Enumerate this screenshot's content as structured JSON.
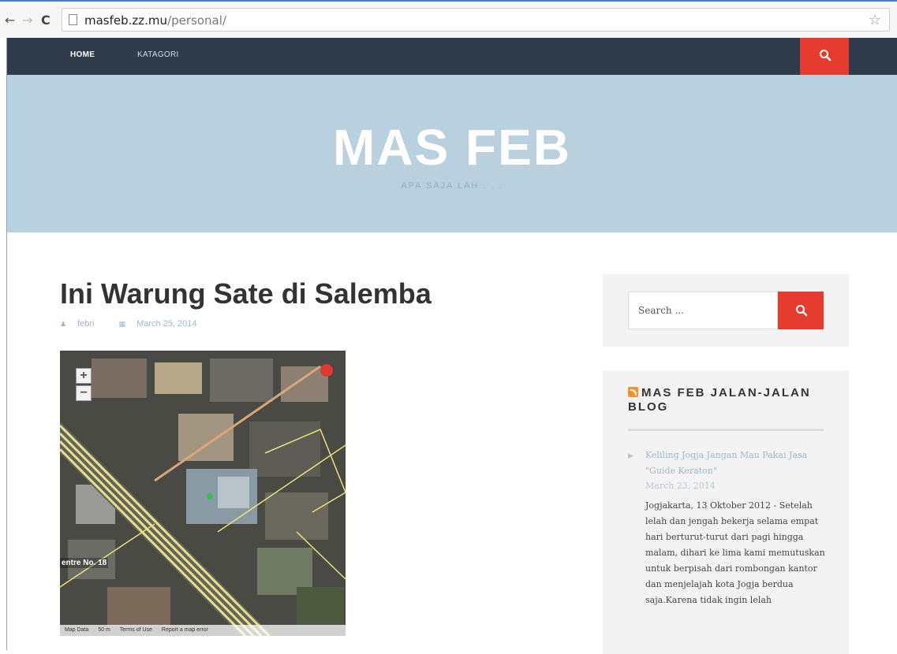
{
  "browser": {
    "back_glyph": "←",
    "forward_glyph": "→",
    "reload_glyph": "C",
    "url_host": "masfeb.zz.mu",
    "url_path": "/personal/",
    "star_glyph": "☆"
  },
  "nav": {
    "home": "HOME",
    "kategori": "KATAGORI"
  },
  "header": {
    "title": "MAS FEB",
    "description": "APA SAJA LAH . . ."
  },
  "post": {
    "title": "Ini Warung Sate di Salemba",
    "author": "febri",
    "date": "March 25, 2014"
  },
  "map": {
    "zoom_in": "+",
    "zoom_out": "−",
    "label": "entre No. 18",
    "footer": [
      "Map Data",
      "50 m",
      "Terms of Use",
      "Report a map error"
    ]
  },
  "sidebar": {
    "search_placeholder": "Search ...",
    "widget_title": "MAS FEB JALAN-JALAN BLOG",
    "rss_item": {
      "title": "Keliling Jogja Jangan Mau Pakai Jasa \"Guide Keraton\"",
      "date": "March 23, 2014",
      "body": "Jogjakarta, 13 Oktober 2012 - Setelah lelah dan jengah bekerja selama empat hari berturut-turut dari pagi hingga malam, dihari ke lima kami memutuskan untuk berpisah dari rombongan kantor dan menjelajah kota Jogja berdua saja.Karena tidak ingin lelah"
    }
  },
  "colors": {
    "nav_bg": "#2e3b4b",
    "accent_red": "#e63c30",
    "header_bg": "#b9d0de",
    "link": "#9fb7c9"
  }
}
